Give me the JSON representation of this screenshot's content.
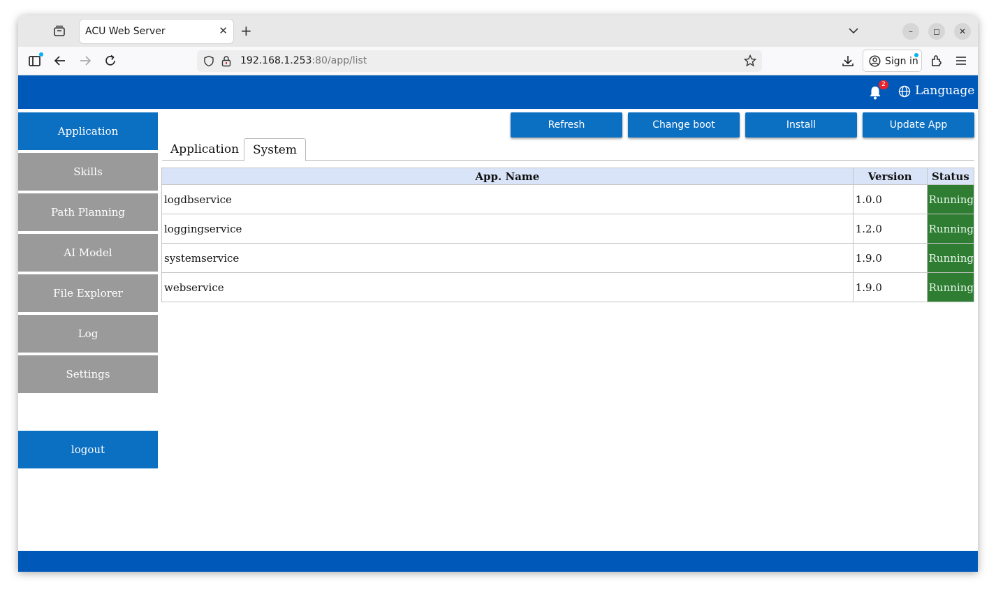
{
  "browser": {
    "tab_title": "ACU Web Server",
    "tab_close": "✕",
    "new_tab": "+",
    "url_host": "192.168.1.253",
    "url_rest": ":80/app/list",
    "sign_in": "Sign in",
    "window_controls": {
      "minimize": "–",
      "maximize": "◻",
      "close": "✕"
    }
  },
  "header": {
    "notification_count": "2",
    "language_label": "Language"
  },
  "sidebar": {
    "items": [
      {
        "label": "Application",
        "active": true
      },
      {
        "label": "Skills",
        "active": false
      },
      {
        "label": "Path Planning",
        "active": false
      },
      {
        "label": "AI Model",
        "active": false
      },
      {
        "label": "File Explorer",
        "active": false
      },
      {
        "label": "Log",
        "active": false
      },
      {
        "label": "Settings",
        "active": false
      }
    ],
    "logout_label": "logout"
  },
  "toolbar": {
    "refresh": "Refresh",
    "change_boot": "Change boot",
    "install": "Install",
    "update_app": "Update App"
  },
  "tabs": [
    {
      "label": "Application",
      "active": false
    },
    {
      "label": "System",
      "active": true
    }
  ],
  "table": {
    "columns": [
      "App. Name",
      "Version",
      "Status"
    ],
    "rows": [
      {
        "name": "logdbservice",
        "version": "1.0.0",
        "status": "Running"
      },
      {
        "name": "loggingservice",
        "version": "1.2.0",
        "status": "Running"
      },
      {
        "name": "systemservice",
        "version": "1.9.0",
        "status": "Running"
      },
      {
        "name": "webservice",
        "version": "1.9.0",
        "status": "Running"
      }
    ]
  },
  "colors": {
    "header_blue": "#0059b8",
    "active_blue": "#0b6fc2",
    "inactive_gray": "#9a9a9a",
    "status_green": "#2e7d32",
    "table_header_bg": "#d9e4f8"
  }
}
